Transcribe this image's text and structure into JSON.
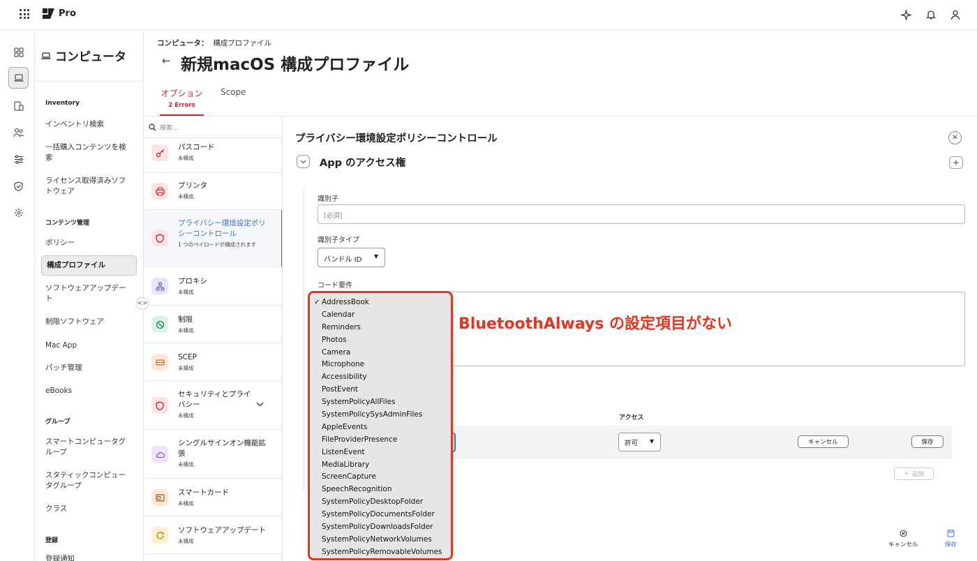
{
  "app": {
    "brand": "Pro"
  },
  "nav": {
    "title": "コンピュータ",
    "sections": {
      "inventory": "Inventory",
      "content": "コンテンツ管理",
      "groups": "グループ",
      "enrollment": "登録"
    },
    "items": [
      "インベントリ検索",
      "一括購入コンテンツを検索",
      "ライセンス取得済みソフトウェア",
      "ポリシー",
      "構成プロファイル",
      "ソフトウェアアップデート",
      "制限ソフトウェア",
      "Mac App",
      "パッチ管理",
      "eBooks",
      "スマートコンピュータグループ",
      "スタティックコンピュータグループ",
      "クラス",
      "登録通知"
    ]
  },
  "header": {
    "breadcrumb_root": "コンピュータ：",
    "breadcrumb_current": "構成プロファイル",
    "title": "新規macOS 構成プロファイル"
  },
  "tabs": {
    "options": "オプション",
    "options_errors": "2 Errors",
    "scope": "Scope"
  },
  "payload_list": {
    "search_placeholder": "検索...",
    "items": [
      {
        "name": "パスコード",
        "status": "未構成"
      },
      {
        "name": "プリンタ",
        "status": "未構成"
      },
      {
        "name": "プライバシー環境設定ポリシーコントロール",
        "status": "1 つのペイロードが構成されます"
      },
      {
        "name": "プロキシ",
        "status": "未構成"
      },
      {
        "name": "制限",
        "status": "未構成"
      },
      {
        "name": "SCEP",
        "status": "未構成"
      },
      {
        "name": "セキュリティとプライバシー",
        "status": "未構成"
      },
      {
        "name": "シングルサインオン機能拡張",
        "status": "未構成"
      },
      {
        "name": "スマートカード",
        "status": "未構成"
      },
      {
        "name": "ソフトウェアアップデート",
        "status": "未構成"
      }
    ]
  },
  "main": {
    "section_title": "プライバシー環境設定ポリシーコントロール",
    "subsection_title": "App のアクセス権",
    "identifier_label": "識別子",
    "identifier_placeholder": "[必須]",
    "identifier_type_label": "識別子タイプ",
    "identifier_type_value": "バンドル ID",
    "code_req_label": "コード要件",
    "access_header": "アクセス",
    "access_value": "許可",
    "row_cancel": "キャンセル",
    "row_save": "保存",
    "add_label": "追加",
    "footer_cancel": "キャンセル",
    "footer_save": "保存"
  },
  "dropdown": {
    "selected": "AddressBook",
    "options": [
      "AddressBook",
      "Calendar",
      "Reminders",
      "Photos",
      "Camera",
      "Microphone",
      "Accessibility",
      "PostEvent",
      "SystemPolicyAllFiles",
      "SystemPolicySysAdminFiles",
      "AppleEvents",
      "FileProviderPresence",
      "ListenEvent",
      "MediaLibrary",
      "ScreenCapture",
      "SpeechRecognition",
      "SystemPolicyDesktopFolder",
      "SystemPolicyDocumentsFolder",
      "SystemPolicyDownloadsFolder",
      "SystemPolicyNetworkVolumes",
      "SystemPolicyRemovableVolumes"
    ]
  },
  "annotation": "BluetoothAlways の設定項目がない",
  "colors": {
    "accent": "#c8232c",
    "link": "#3b6fd4",
    "annotation": "#e8331e"
  }
}
